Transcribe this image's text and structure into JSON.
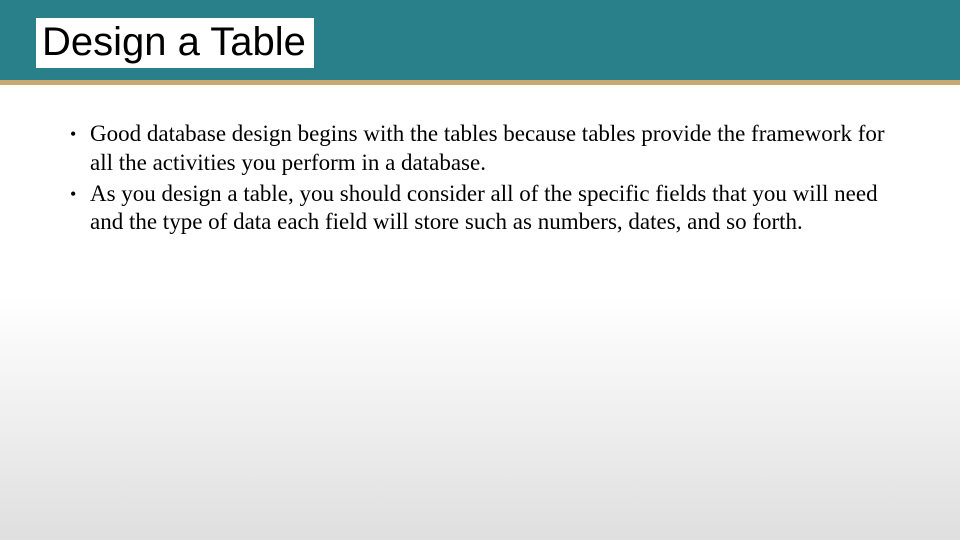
{
  "title": "Design a Table",
  "bullets": [
    "Good database design begins with the tables because tables provide the framework for all the activities you perform in a database.",
    "As you design a table, you should consider all of the specific fields that you will need and the type of data each field will store such as numbers, dates, and so forth."
  ],
  "colors": {
    "header_bg": "#29808a",
    "accent_line": "#c8a971"
  }
}
